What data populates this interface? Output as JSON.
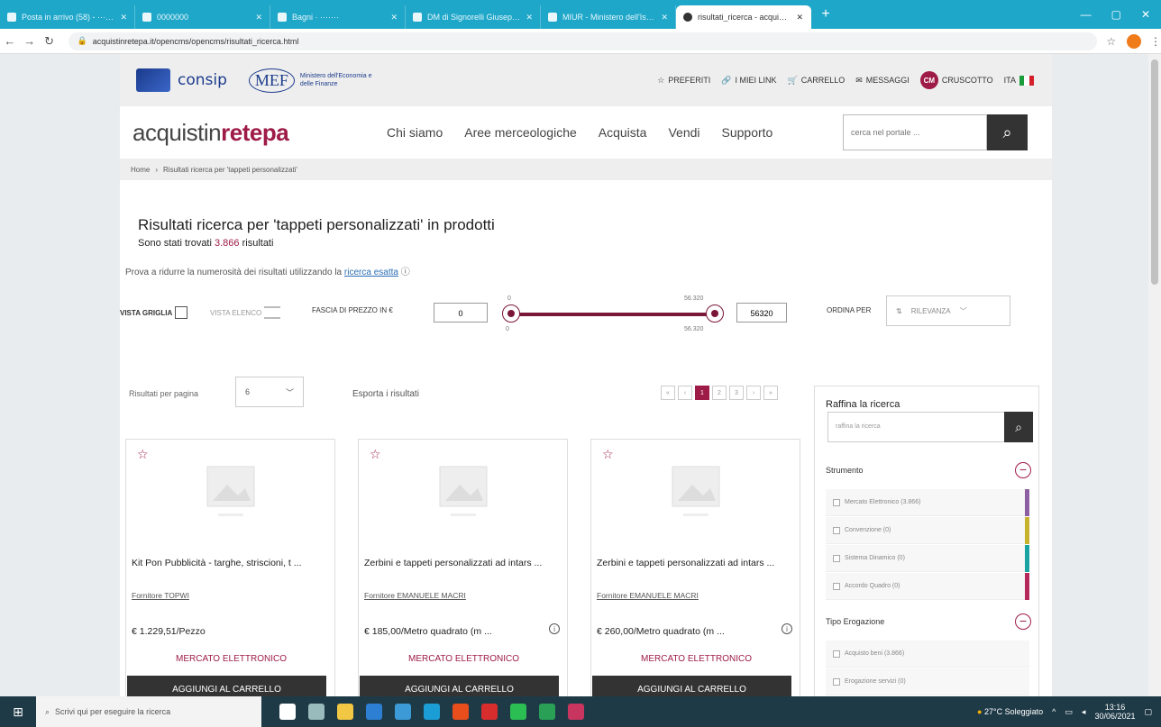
{
  "browser": {
    "tabs": [
      {
        "title": "Posta in arrivo (58) - ·········"
      },
      {
        "title": "0000000"
      },
      {
        "title": "Bagni · ·······"
      },
      {
        "title": "DM di Signorelli Giuseppe"
      },
      {
        "title": "MIUR - Ministero dell'Istruzione"
      },
      {
        "title": "risultati_ricerca - acquistinrete"
      }
    ],
    "url": "acquistinretepa.it/opencms/opencms/risultati_ricerca.html"
  },
  "topbar": {
    "consip": "consip",
    "mef": "MEF",
    "mef_sub": "Ministero dell'Economia e delle Finanze",
    "links": [
      "PREFERITI",
      "I MIEI LINK",
      "CARRELLO",
      "MESSAGGI"
    ],
    "user_initials": "CM",
    "cruscotto": "CRUSCOTTO",
    "lang": "ITA",
    "flag_colors": [
      "#1a9b3c",
      "#ffffff",
      "#d5202a"
    ]
  },
  "header": {
    "brand_a": "acquistin",
    "brand_b": "rete",
    "brand_c": "pa",
    "nav": [
      "Chi siamo",
      "Aree merceologiche",
      "Acquista",
      "Vendi",
      "Supporto"
    ],
    "search_placeholder": "cerca nel portale ..."
  },
  "breadcrumb": {
    "home": "Home",
    "current": "Risultati ricerca per 'tappeti personalizzati'"
  },
  "results": {
    "title": "Risultati ricerca per 'tappeti personalizzati' in prodotti",
    "count_prefix": "Sono stati trovati",
    "count": "3.866",
    "count_suffix": "risultati",
    "hint": "Prova a ridurre la numerosità dei risultati utilizzando la",
    "hint_link": "ricerca esatta"
  },
  "controls": {
    "vista_griglia": "VISTA GRIGLIA",
    "vista_elenco": "VISTA ELENCO",
    "fascia": "FASCIA DI PREZZO IN €",
    "price_min": "0",
    "price_max": "56320",
    "slider_min_label": "0",
    "slider_max_label": "56.320",
    "ordina": "ORDINA PER",
    "order_value": "RILEVANZA",
    "per_page_label": "Risultati per pagina",
    "per_page_value": "6",
    "esporta": "Esporta i risultati",
    "pages": [
      "«",
      "‹",
      "1",
      "2",
      "3",
      "›",
      "»"
    ]
  },
  "products": [
    {
      "title": "Kit Pon Pubblicità - targhe, striscioni, t ...",
      "supplier": "Fornitore TOPWI",
      "price": "€ 1.229,51/Pezzo",
      "market": "MERCATO ELETTRONICO",
      "add": "AGGIUNGI AL CARRELLO"
    },
    {
      "title": "Zerbini e tappeti personalizzati ad intars ...",
      "supplier": "Fornitore EMANUELE MACRI",
      "price": "€ 185,00/Metro quadrato (m ...",
      "market": "MERCATO ELETTRONICO",
      "add": "AGGIUNGI AL CARRELLO"
    },
    {
      "title": "Zerbini e tappeti personalizzati ad intars ...",
      "supplier": "Fornitore EMANUELE MACRI",
      "price": "€ 260,00/Metro quadrato (m ...",
      "market": "MERCATO ELETTRONICO",
      "add": "AGGIUNGI AL CARRELLO"
    }
  ],
  "sidebar": {
    "title": "Raffina la ricerca",
    "placeholder": "raffina la ricerca",
    "group1": "Strumento",
    "group1_options": [
      {
        "label": "Mercato Elettronico (3.866)",
        "color": "#8e5ea2"
      },
      {
        "label": "Convenzione (0)",
        "color": "#c7b22d"
      },
      {
        "label": "Sistema Dinamico (0)",
        "color": "#1aa3a3"
      },
      {
        "label": "Accordo Quadro (0)",
        "color": "#b5285a"
      }
    ],
    "group2": "Tipo Erogazione",
    "group2_options": [
      {
        "label": "Acquisto beni (3.866)"
      },
      {
        "label": "Erogazione servizi (0)"
      }
    ]
  },
  "taskbar": {
    "search": "Scrivi qui per eseguire la ricerca",
    "weather": "27°C Soleggiato",
    "time": "13:16",
    "date": "30/06/2021"
  }
}
